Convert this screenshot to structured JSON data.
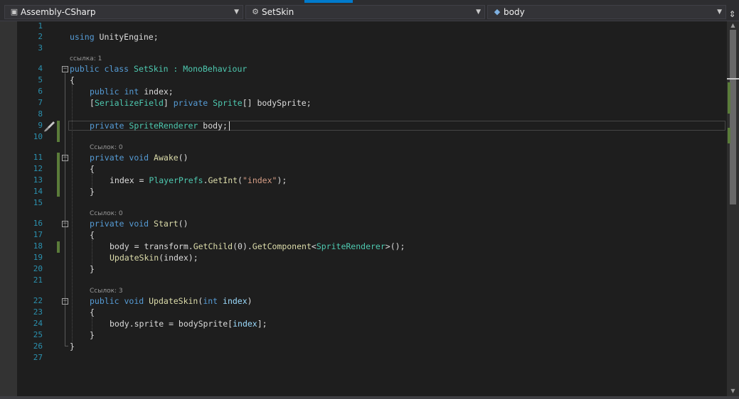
{
  "navbar": {
    "project": "Assembly-CSharp",
    "type": "SetSkin",
    "member": "body"
  },
  "icons": {
    "project": "csharp-project-icon",
    "type": "class-icon",
    "member": "field-icon",
    "split": "split-editor-icon",
    "gutter": "paint-brush-icon"
  },
  "colors": {
    "background": "#1e1e1e",
    "keyword": "#569cd6",
    "type": "#4ec9b0",
    "method": "#dcdcaa",
    "string": "#d69d85",
    "line_number": "#2b91af",
    "change_marker": "#5b7c3a"
  },
  "line_numbers": [
    "1",
    "2",
    "3",
    "4",
    "5",
    "6",
    "7",
    "8",
    "9",
    "10",
    "11",
    "12",
    "13",
    "14",
    "15",
    "16",
    "17",
    "18",
    "19",
    "20",
    "21",
    "22",
    "23",
    "24",
    "25",
    "26",
    "27"
  ],
  "codelens": {
    "setskin": "ссылка: 1",
    "awake": "Ссылок: 0",
    "start": "Ссылок: 0",
    "updateskin": "Ссылок: 3"
  },
  "code": {
    "l2": {
      "kw": "using",
      "rest": " UnityEngine;"
    },
    "l4": {
      "k1": "public",
      "k2": "class",
      "name": " SetSkin : ",
      "base": "MonoBehaviour"
    },
    "l5": "{",
    "l6": {
      "k1": "public",
      "k2": "int",
      "rest": " index;"
    },
    "l7": {
      "open": "[",
      "attr": "SerializeField",
      "close": "] ",
      "k1": "private",
      "ty": "Sprite",
      "rest": "[] bodySprite;"
    },
    "l9": {
      "k1": "private",
      "ty": "SpriteRenderer",
      "rest": " body;"
    },
    "l11": {
      "k1": "private",
      "k2": "void",
      "fn": "Awake",
      "rest": "()"
    },
    "l12": "{",
    "l13": {
      "a": "index = ",
      "ty": "PlayerPrefs",
      "dot": ".",
      "fn": "GetInt",
      "open": "(",
      "str": "\"index\"",
      "close": ");"
    },
    "l14": "}",
    "l16": {
      "k1": "private",
      "k2": "void",
      "fn": "Start",
      "rest": "()"
    },
    "l17": "{",
    "l18": {
      "a": "body = transform.",
      "fn1": "GetChild",
      "b": "(0).",
      "fn2": "GetComponent",
      "c": "<",
      "ty": "SpriteRenderer",
      "d": ">();"
    },
    "l19": {
      "fn": "UpdateSkin",
      "rest": "(index);"
    },
    "l20": "}",
    "l22": {
      "k1": "public",
      "k2": "void",
      "fn": "UpdateSkin",
      "open": "(",
      "k3": "int",
      "par": "index",
      "close": ")"
    },
    "l23": "{",
    "l24": {
      "a": "body.sprite = bodySprite[",
      "par": "index",
      "b": "];"
    },
    "l25": "}",
    "l26": "}"
  }
}
